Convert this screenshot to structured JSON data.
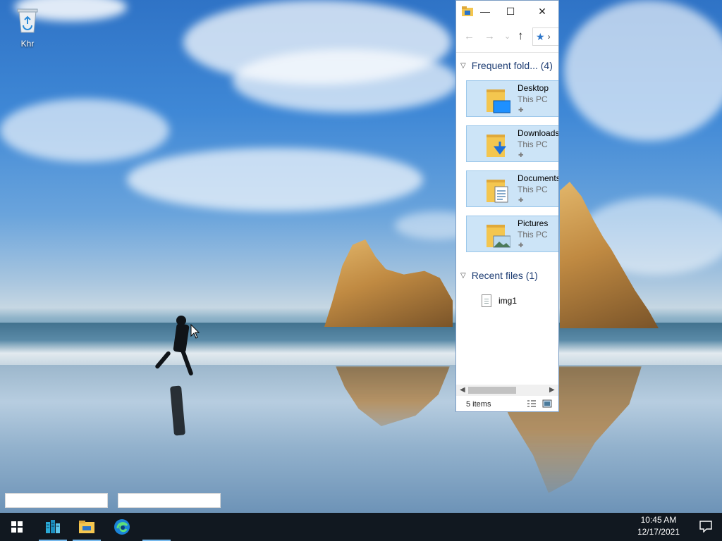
{
  "desktop": {
    "recycle_bin_label": "Khr"
  },
  "explorer": {
    "title_controls": {
      "minimize": "—",
      "maximize": "☐",
      "close": "✕"
    },
    "nav": {
      "back": "←",
      "forward": "→",
      "recent": "⌄",
      "up": "↑",
      "address_chevron": "›"
    },
    "frequent_header": "Frequent fold... (4)",
    "folders": [
      {
        "name": "Desktop",
        "location": "This PC",
        "icon": "desktop-folder-icon"
      },
      {
        "name": "Downloads",
        "location": "This PC",
        "icon": "downloads-folder-icon"
      },
      {
        "name": "Documents",
        "location": "This PC",
        "icon": "documents-folder-icon"
      },
      {
        "name": "Pictures",
        "location": "This PC",
        "icon": "pictures-folder-icon"
      }
    ],
    "recent_header": "Recent files (1)",
    "recent_files": [
      {
        "name": "img1",
        "icon": "file-icon"
      }
    ],
    "status": "5 items"
  },
  "taskbar": {
    "items": [
      "start-icon",
      "server-manager-icon",
      "file-explorer-icon",
      "edge-icon"
    ],
    "clock": {
      "time": "10:45 AM",
      "date": "12/17/2021"
    }
  },
  "colors": {
    "accent": "#2a74c9",
    "selection": "#cce4f7",
    "taskbar": "#111820",
    "folder_yellow": "#f4c64f"
  }
}
